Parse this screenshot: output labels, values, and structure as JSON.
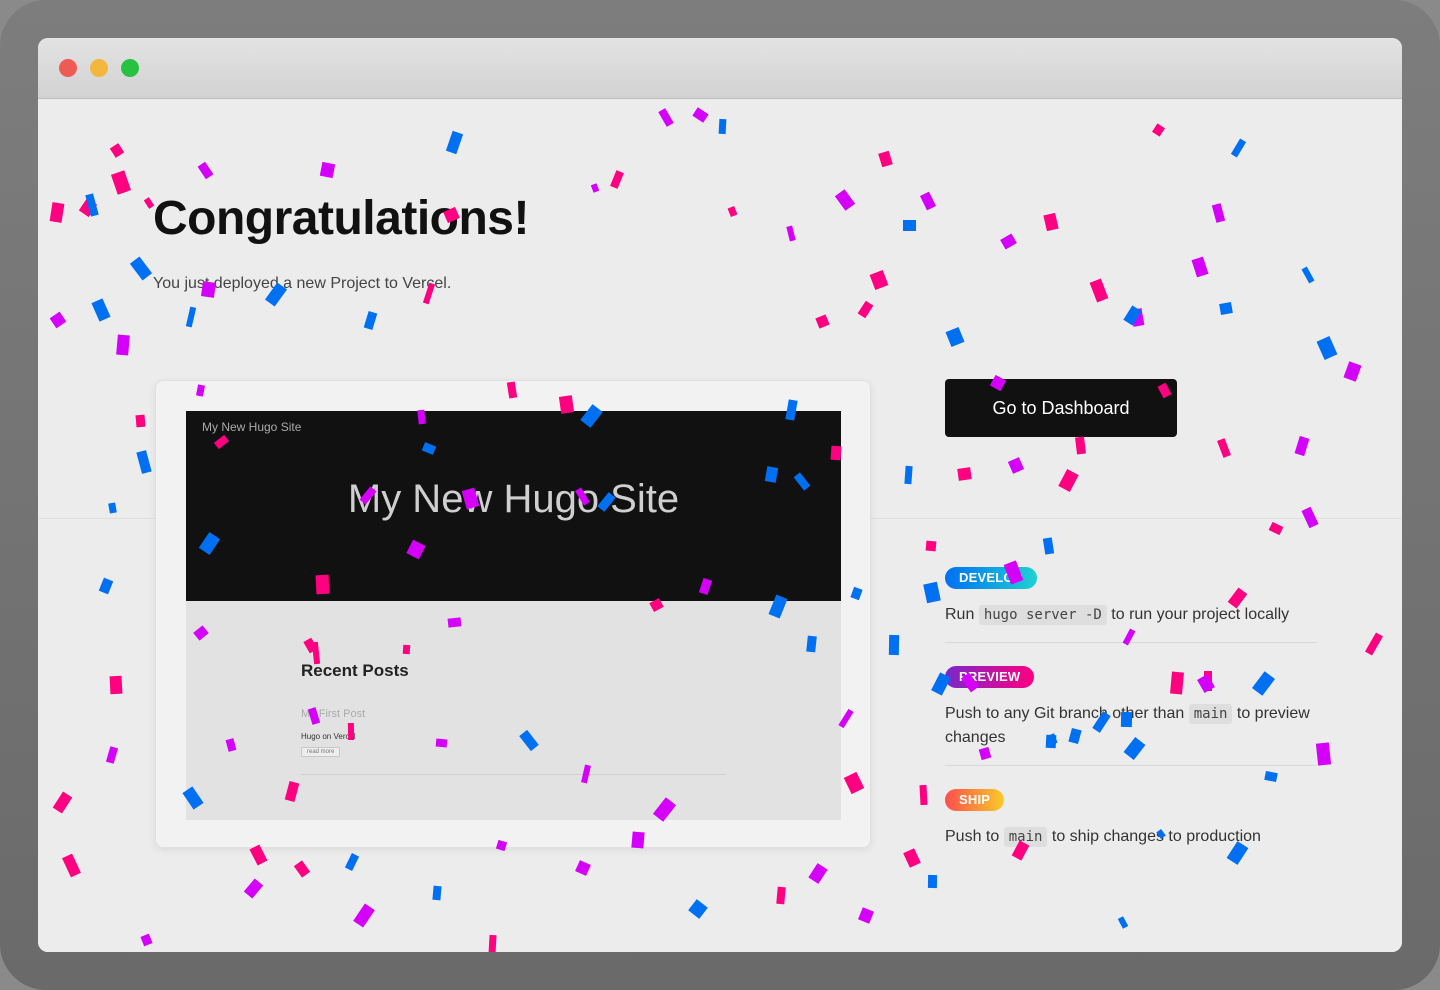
{
  "heading": {
    "title": "Congratulations!",
    "subtitle": "You just deployed a new Project to Vercel."
  },
  "preview": {
    "site_name_small": "My New Hugo Site",
    "site_name_big": "My New Hugo Site",
    "section_title": "Recent Posts",
    "post_title": "My First Post",
    "post_description": "Hugo on Vercel",
    "read_more": "read more"
  },
  "actions": {
    "dashboard_label": "Go to Dashboard"
  },
  "steps": [
    {
      "badge": "DEVELOP",
      "text_before": "Run",
      "code": "hugo server -D",
      "text_after": "to run your project locally"
    },
    {
      "badge": "PREVIEW",
      "text_before": "Push to any Git branch other than",
      "code": "main",
      "text_after": "to preview changes"
    },
    {
      "badge": "SHIP",
      "text_before": "Push to",
      "code": "main",
      "text_after": "to ship changes to production"
    }
  ],
  "colors": {
    "confetti": [
      "#ff0080",
      "#0070f3",
      "#d500f9"
    ],
    "button_bg": "#111111"
  }
}
